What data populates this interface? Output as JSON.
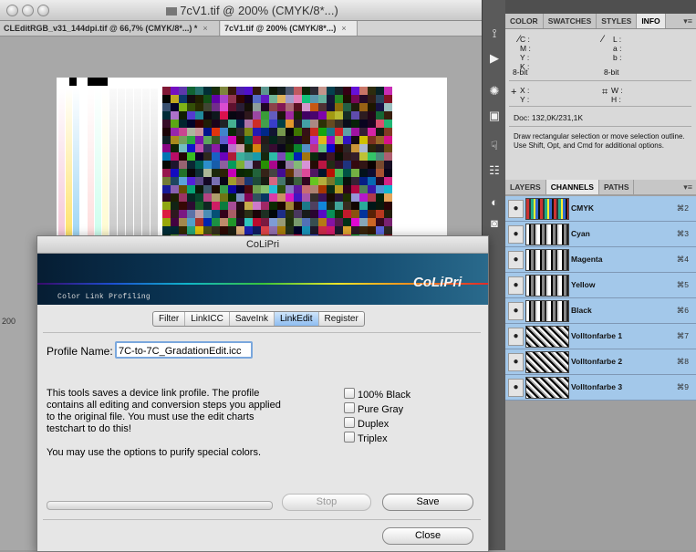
{
  "window": {
    "title": "7cV1.tif @ 200% (CMYK/8*...)",
    "tabs": [
      {
        "label": "CLEditRGB_v31_144dpi.tif @ 66,7% (CMYK/8*...)",
        "suffix": "*",
        "close": "×"
      },
      {
        "label": "7cV1.tif @ 200% (CMYK/8*...)",
        "suffix": "",
        "close": "×"
      }
    ],
    "zoom": "200"
  },
  "tools": [
    "3D-icon",
    "play-icon",
    "star-icon",
    "image-icon",
    "hand-icon",
    "layers-icon",
    "circle-icon",
    "mask-icon"
  ],
  "info_panel": {
    "tabs": [
      "COLOR",
      "SWATCHES",
      "STYLES",
      "INFO"
    ],
    "active_tab": "INFO",
    "cmyk_labels": "C :\nM :\nY :\nK :",
    "lab_labels": "L :\na :\nb :",
    "bits_left": "8-bit",
    "bits_right": "8-bit",
    "xy_labels": "X :\nY :",
    "wh_labels": "W :\nH :",
    "doc": "Doc: 132,0K/231,1K",
    "hint": "Draw rectangular selection or move selection outline.  Use Shift, Opt, and Cmd for additional options."
  },
  "channels_panel": {
    "tabs": [
      "LAYERS",
      "CHANNELS",
      "PATHS"
    ],
    "active_tab": "CHANNELS",
    "channels": [
      {
        "name": "CMYK",
        "shortcut": "⌘2"
      },
      {
        "name": "Cyan",
        "shortcut": "⌘3"
      },
      {
        "name": "Magenta",
        "shortcut": "⌘4"
      },
      {
        "name": "Yellow",
        "shortcut": "⌘5"
      },
      {
        "name": "Black",
        "shortcut": "⌘6"
      },
      {
        "name": "Volltonfarbe 1",
        "shortcut": "⌘7"
      },
      {
        "name": "Volltonfarbe 2",
        "shortcut": "⌘8"
      },
      {
        "name": "Volltonfarbe 3",
        "shortcut": "⌘9"
      }
    ]
  },
  "dialog": {
    "title": "CoLiPri",
    "banner_subtitle": "Color Link Profiling",
    "logo": "CoLiPri",
    "tabs": [
      "Filter",
      "LinkICC",
      "SaveInk",
      "LinkEdit",
      "Register"
    ],
    "active_tab": "LinkEdit",
    "profile_label": "Profile Name:",
    "profile_value": "7C-to-7C_GradationEdit.icc",
    "description": [
      "This tools saves a device link profile. The profile",
      "contains all editing and conversion steps you applied",
      "to the original  file. You must use the edit charts",
      "testchart to do this!",
      "",
      "You may use the options to purify  special colors."
    ],
    "options": [
      "100% Black",
      "Pure Gray",
      "Duplex",
      "Triplex"
    ],
    "stop_label": "Stop",
    "save_label": "Save",
    "close_label": "Close",
    "accent": "#8ebdf1"
  }
}
